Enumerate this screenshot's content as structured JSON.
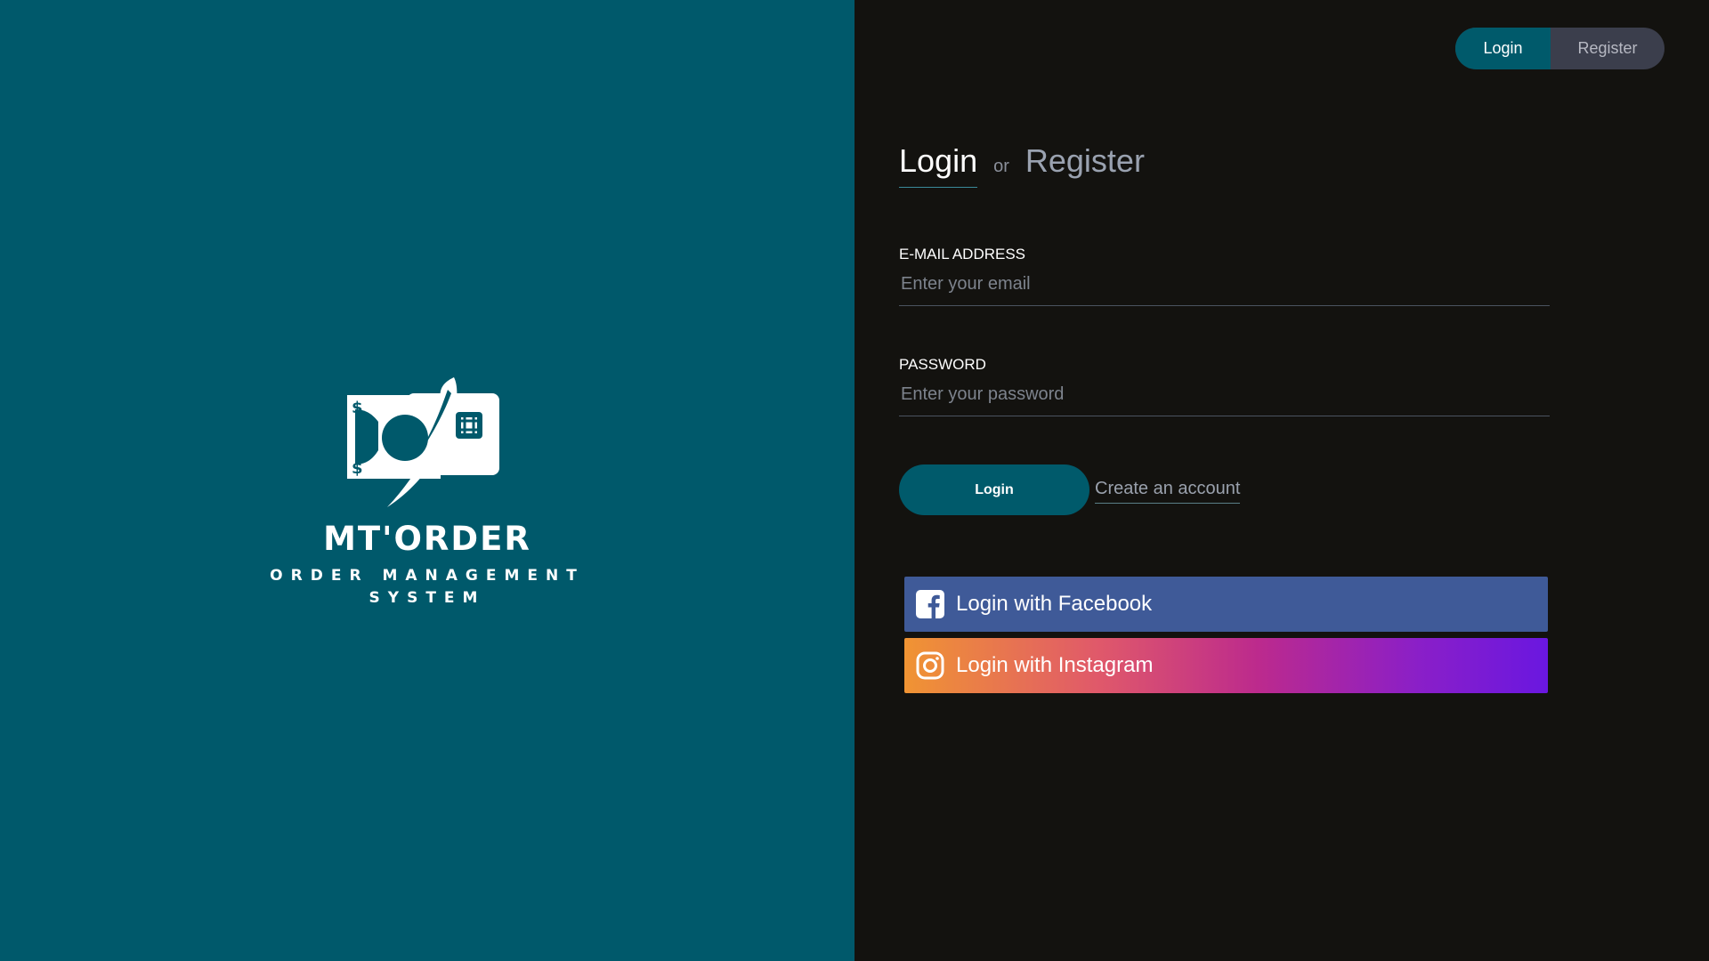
{
  "brand": {
    "name": "MT'ORDER",
    "tagline_line1": "ORDER MANAGEMENT",
    "tagline_line2": "SYSTEM",
    "logo_icon": "money-card-logo-icon",
    "panel_color": "#00596b"
  },
  "top_switch": {
    "login_label": "Login",
    "register_label": "Register",
    "active": "Login"
  },
  "heading": {
    "login": "Login",
    "or": "or",
    "register": "Register"
  },
  "form": {
    "email_label": "E-MAIL ADDRESS",
    "email_placeholder": "Enter your email",
    "password_label": "PASSWORD",
    "password_placeholder": "Enter your password",
    "submit_label": "Login",
    "create_account": "Create an account"
  },
  "social": {
    "facebook_label": "Login with Facebook",
    "facebook_icon": "facebook-icon",
    "facebook_color": "#3f5a98",
    "instagram_label": "Login with Instagram",
    "instagram_icon": "instagram-icon"
  },
  "colors": {
    "accent": "#005a6b",
    "background": "#13120f"
  }
}
